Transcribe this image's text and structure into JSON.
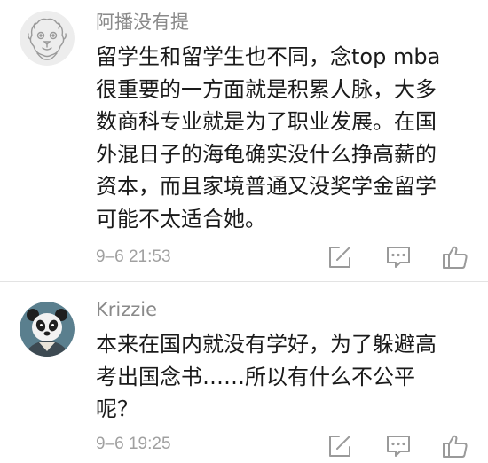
{
  "comments": [
    {
      "username": "阿播没有提",
      "avatar_icon": "lion-mascot-icon",
      "lines": [
        "留学生和留学生也不同，念top mba",
        "很重要的一方面就是积累人脉，大多",
        "数商科专业就是为了职业发展。在国",
        "外混日子的海龟确实没什么挣高薪的",
        "资本，而且家境普通又没奖学金留学",
        "可能不太适合她。"
      ],
      "time": "9–6 21:53",
      "actions": [
        "edit-icon",
        "reply-icon",
        "like-icon"
      ]
    },
    {
      "username": "Krizzie",
      "avatar_icon": "panda-icon",
      "lines": [
        "本来在国内就没有学好，为了躲避高",
        "考出国念书……所以有什么不公平",
        "呢？"
      ],
      "time": "9–6 19:25",
      "actions": [
        "edit-icon",
        "reply-icon",
        "like-icon"
      ]
    }
  ],
  "colors": {
    "text": "#1a1a1a",
    "username": "#8a8a8a",
    "meta": "#a0a0a0",
    "icon": "#9a9a9a",
    "divider": "#e3e3e3"
  }
}
